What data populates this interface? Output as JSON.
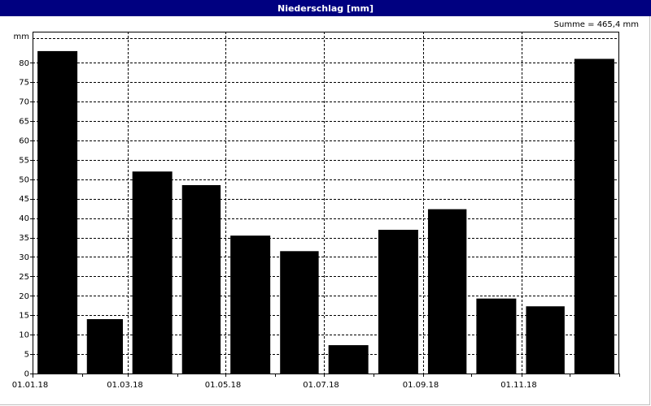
{
  "window": {
    "title": "Niederschlag [mm]",
    "sum_label": "Summe = 465,4 mm"
  },
  "colors": {
    "title_bar": "#000080",
    "bars": "#000000",
    "grid": "#000000"
  },
  "chart_data": {
    "type": "bar",
    "title": "Niederschlag [mm]",
    "ylabel": "mm",
    "xlabel": "",
    "ylim": [
      0,
      88
    ],
    "yticks": [
      0,
      5,
      10,
      15,
      20,
      25,
      30,
      35,
      40,
      45,
      50,
      55,
      60,
      65,
      70,
      75,
      80
    ],
    "x_tick_labels": [
      "01.01.18",
      "01.03.18",
      "01.05.18",
      "01.07.18",
      "01.09.18",
      "01.11.18"
    ],
    "categories": [
      "01.2018",
      "02.2018",
      "03.2018",
      "04.2018",
      "05.2018",
      "06.2018",
      "07.2018",
      "08.2018",
      "09.2018",
      "10.2018",
      "11.2018",
      "12.2018"
    ],
    "values": [
      83,
      14,
      52,
      48.5,
      35.5,
      31.5,
      7.3,
      37,
      42.3,
      19.3,
      17.3,
      81
    ],
    "grid": true,
    "grid_style": "dashed"
  }
}
